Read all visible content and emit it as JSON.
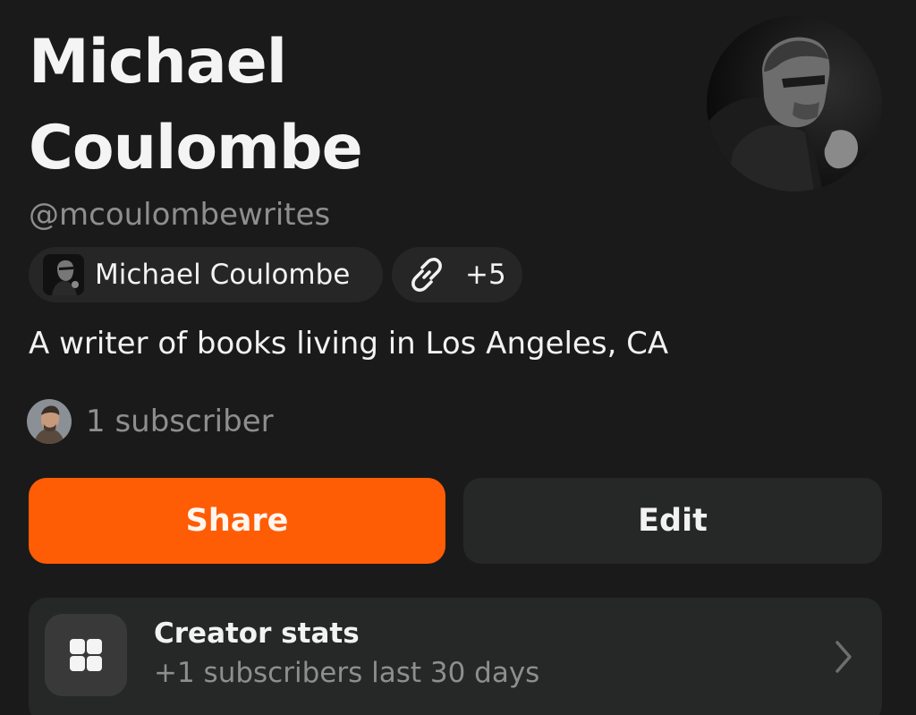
{
  "profile": {
    "name_line1": "Michael",
    "name_line2": "Coulombe",
    "handle": "@mcoulombewrites",
    "bio": "A writer of books living in Los Angeles, CA"
  },
  "chips": {
    "account_label": "Michael Coulombe",
    "links_label": "+5"
  },
  "subscribers": {
    "text": "1 subscriber"
  },
  "actions": {
    "share_label": "Share",
    "edit_label": "Edit"
  },
  "stats_card": {
    "title": "Creator stats",
    "subtitle": "+1 subscribers last 30 days"
  },
  "icons": {
    "link": "link-icon",
    "grid": "grid-icon",
    "chevron": "chevron-right-icon"
  },
  "colors": {
    "background": "#1a1a1a",
    "accent": "#ff5c06",
    "surface": "#262727",
    "muted_text": "#8e8e8e"
  }
}
